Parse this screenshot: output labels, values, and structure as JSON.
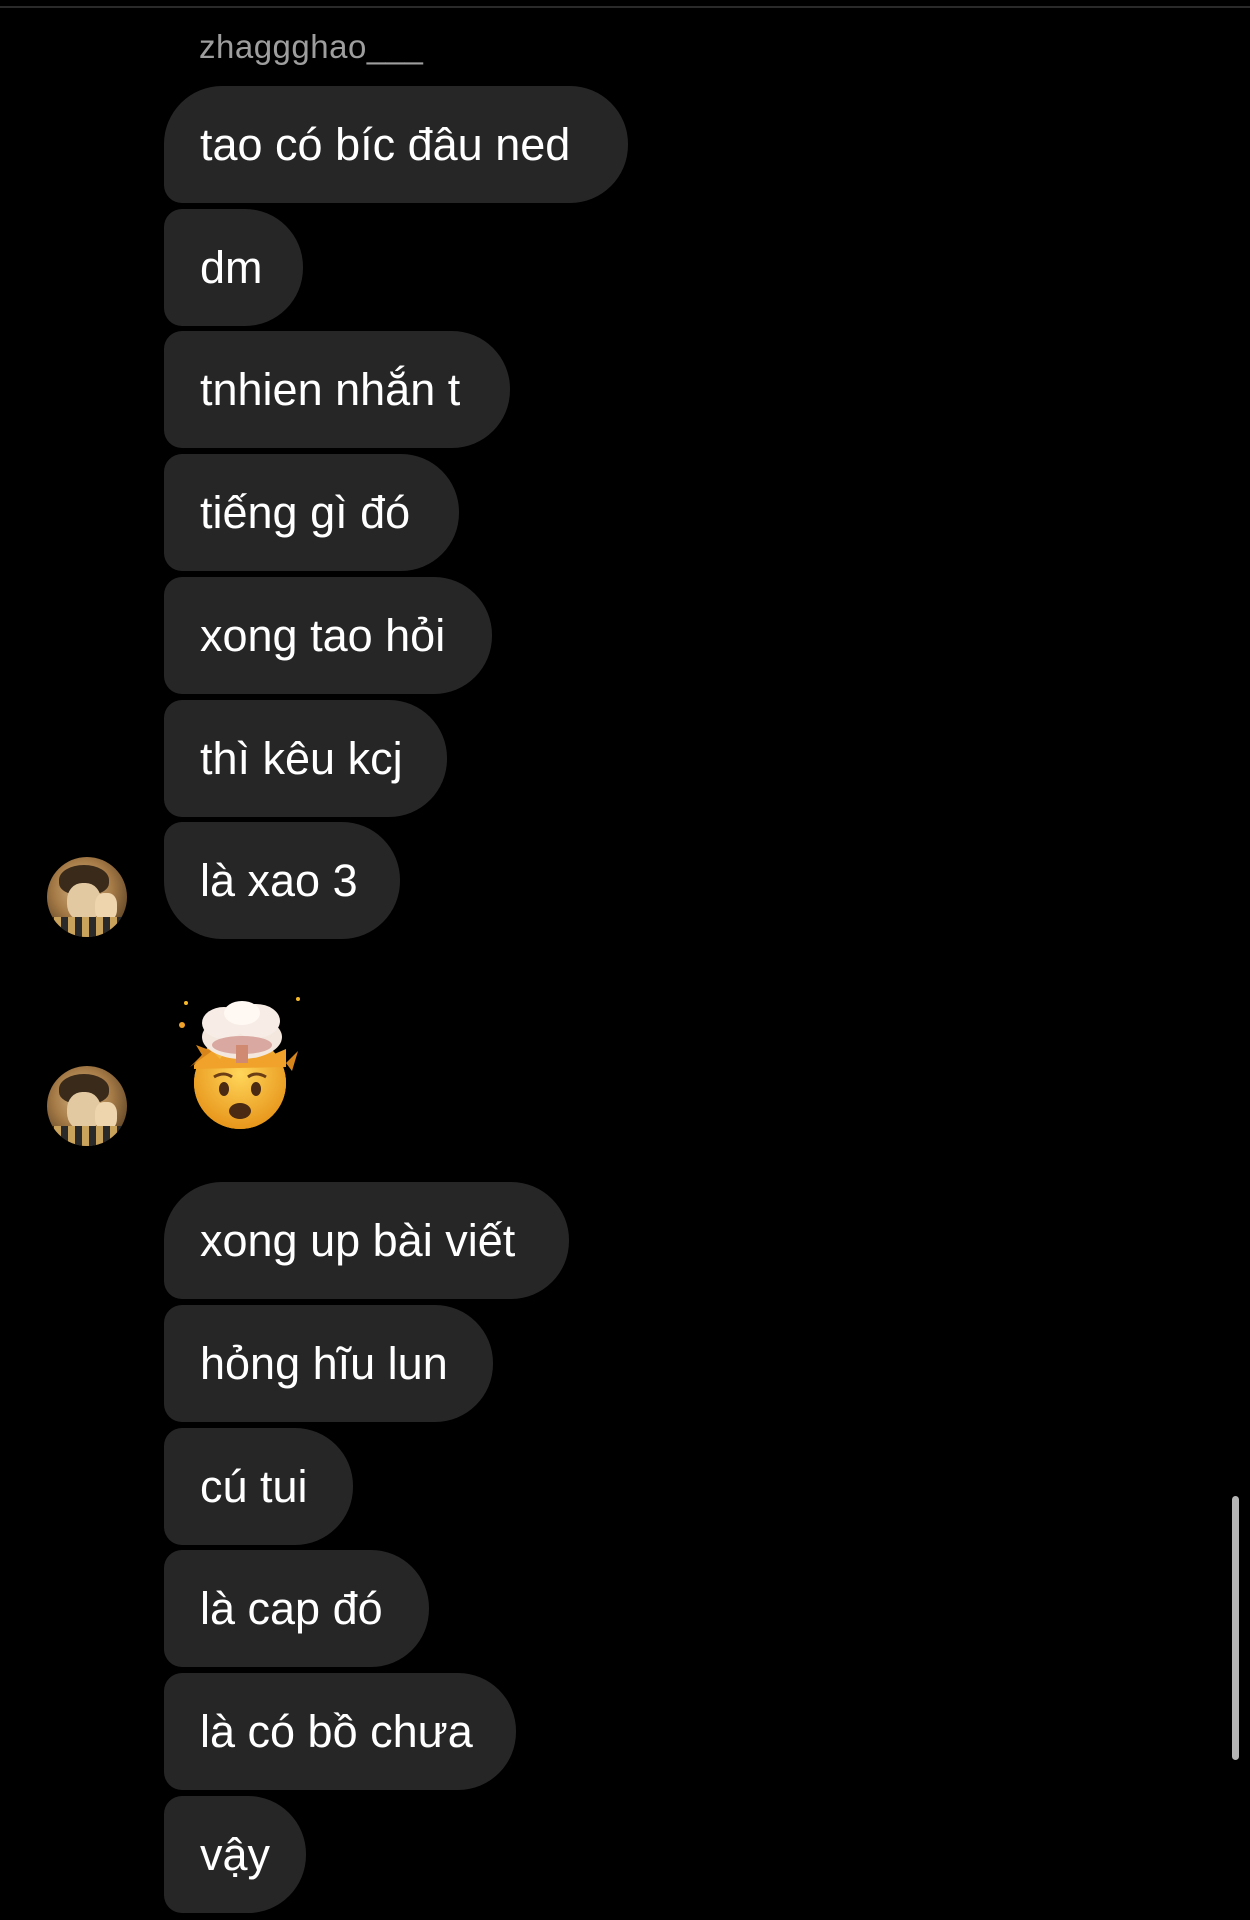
{
  "thread": {
    "sender_name": "zhaggghao___",
    "messages_group_1": [
      "tao có bíc đâu ned",
      "dm",
      "tnhien nhắn t",
      "tiếng gì đó",
      "xong tao hỏi",
      "thì kêu kcj",
      "là xao 3"
    ],
    "emoji_reaction": "exploding-head-emoji",
    "messages_group_2": [
      "xong up bài viết",
      "hỏng hĩu lun",
      "cú tui",
      "là cap đó",
      "là có bồ chưa",
      "vậy"
    ]
  },
  "colors": {
    "background": "#000000",
    "bubble": "#262626",
    "sender_name": "#9e9e9e",
    "text": "#ffffff"
  }
}
